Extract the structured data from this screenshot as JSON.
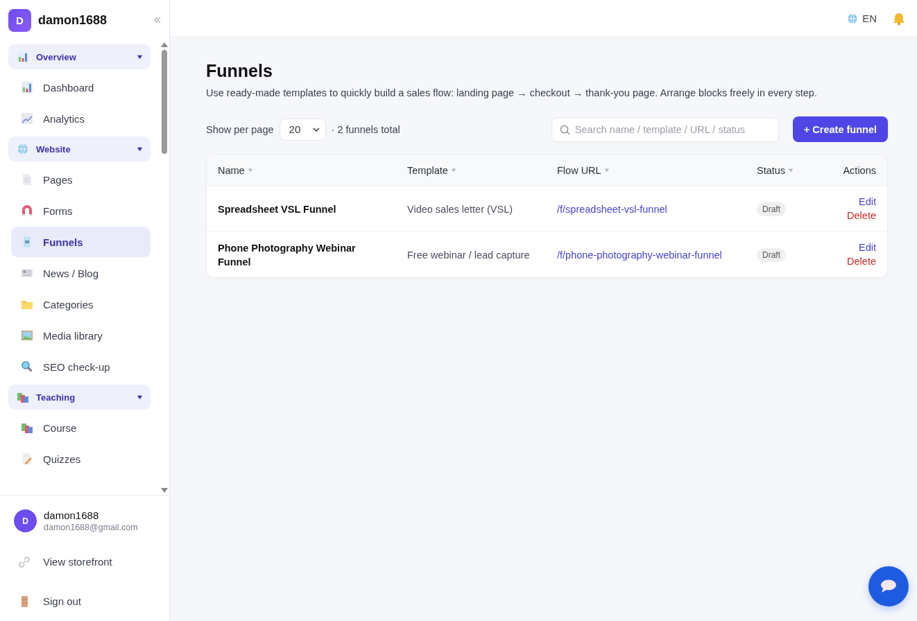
{
  "brand": {
    "initial": "D",
    "name": "damon1688"
  },
  "nav": [
    {
      "label": "Overview",
      "expanded": true,
      "children": [
        {
          "label": "Dashboard",
          "selected": false
        },
        {
          "label": "Analytics",
          "selected": false
        }
      ]
    },
    {
      "label": "Website",
      "expanded": true,
      "children": [
        {
          "label": "Pages",
          "selected": false
        },
        {
          "label": "Forms",
          "selected": false
        },
        {
          "label": "Funnels",
          "selected": true
        },
        {
          "label": "News / Blog",
          "selected": false
        },
        {
          "label": "Categories",
          "selected": false
        },
        {
          "label": "Media library",
          "selected": false
        },
        {
          "label": "SEO check-up",
          "selected": false
        }
      ]
    },
    {
      "label": "Teaching",
      "expanded": true,
      "children": [
        {
          "label": "Course",
          "selected": false
        },
        {
          "label": "Quizzes",
          "selected": false
        }
      ]
    }
  ],
  "user": {
    "initial": "D",
    "name": "damon1688",
    "email": "damon1688@gmail.com"
  },
  "footer_links": [
    "View storefront",
    "Sign out"
  ],
  "topbar": {
    "language": "EN"
  },
  "page": {
    "title": "Funnels",
    "description": "Use ready-made templates to quickly build a sales flow: landing page → checkout → thank-you page. Arrange blocks freely in every step."
  },
  "toolbar": {
    "per_page_label": "Show per page",
    "per_page": "20",
    "total": "· 2 funnels total",
    "search": {
      "placeholder": "Search name / template / URL / status"
    },
    "create_button": "+ Create funnel"
  },
  "table": {
    "columns": [
      {
        "label": "Name",
        "sortable": true
      },
      {
        "label": "Template",
        "sortable": true
      },
      {
        "label": "Flow URL",
        "sortable": true
      },
      {
        "label": "Status",
        "sortable": true
      },
      {
        "label": "Actions",
        "sortable": false
      }
    ],
    "rows": [
      {
        "name": "Spreadsheet VSL Funnel",
        "template": "Video sales letter (VSL)",
        "url": "/f/spreadsheet-vsl-funnel",
        "status": "Draft",
        "actions": [
          "Edit",
          "Delete"
        ]
      },
      {
        "name": "Phone Photography Webinar Funnel",
        "template": "Free webinar / lead capture",
        "url": "/f/phone-photography-webinar-funnel",
        "status": "Draft",
        "actions": [
          "Edit",
          "Delete"
        ]
      }
    ]
  }
}
